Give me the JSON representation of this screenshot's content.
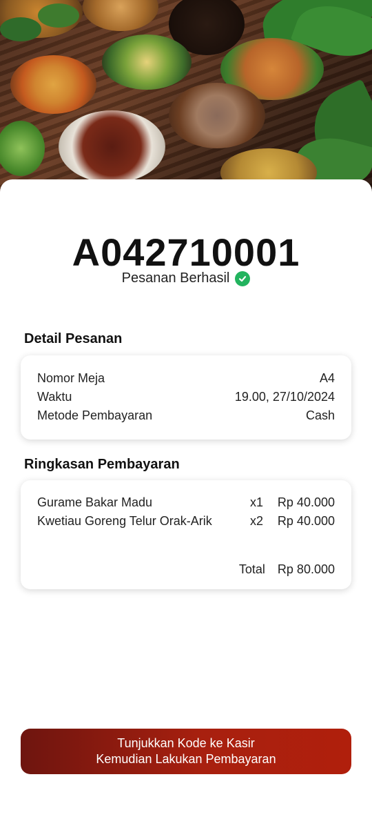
{
  "order": {
    "code": "A042710001",
    "status": "Pesanan Berhasil"
  },
  "detail": {
    "title": "Detail Pesanan",
    "rows": [
      {
        "label": "Nomor Meja",
        "value": "A4"
      },
      {
        "label": "Waktu",
        "value": "19.00, 27/10/2024"
      },
      {
        "label": "Metode Pembayaran",
        "value": "Cash"
      }
    ]
  },
  "summary": {
    "title": "Ringkasan Pembayaran",
    "items": [
      {
        "name": "Gurame Bakar Madu",
        "qty": "x1",
        "price": "Rp 40.000"
      },
      {
        "name": "Kwetiau Goreng Telur Orak-Arik",
        "qty": "x2",
        "price": "Rp 40.000"
      }
    ],
    "total_label": "Total",
    "total_value": "Rp 80.000"
  },
  "cta": {
    "line1": "Tunjukkan Kode ke Kasir",
    "line2": "Kemudian Lakukan Pembayaran"
  },
  "colors": {
    "success": "#22b35e",
    "cta_start": "#6e150f",
    "cta_end": "#b01f0c"
  },
  "icons": {
    "status": "check-circle-icon"
  }
}
